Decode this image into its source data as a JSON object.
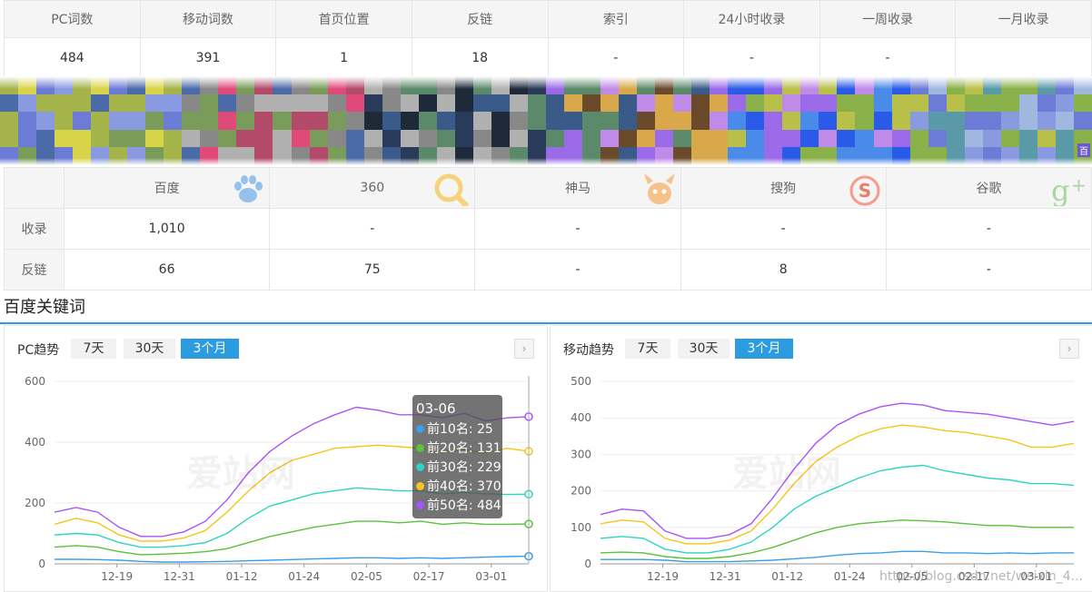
{
  "stats": {
    "headers": [
      "PC词数",
      "移动词数",
      "首页位置",
      "反链",
      "索引",
      "24小时收录",
      "一周收录",
      "一月收录"
    ],
    "values": [
      "484",
      "391",
      "1",
      "18",
      "-",
      "-",
      "-",
      ""
    ]
  },
  "banner": {
    "tag": "百"
  },
  "engines": {
    "headers": [
      "",
      "百度",
      "360",
      "神马",
      "搜狗",
      "谷歌"
    ],
    "icons": [
      "paw-icon",
      "magnifier-icon",
      "shenma-icon",
      "sogou-icon",
      "google-plus-icon"
    ],
    "rows": [
      {
        "label": "收录",
        "values": [
          "1,010",
          "-",
          "-",
          "-",
          "-"
        ]
      },
      {
        "label": "反链",
        "values": [
          "66",
          "75",
          "-",
          "8",
          "-"
        ]
      }
    ]
  },
  "section": {
    "title": "百度关键词"
  },
  "panels": [
    {
      "label": "PC趋势",
      "tabs": [
        {
          "label": "7天",
          "active": false
        },
        {
          "label": "30天",
          "active": false
        },
        {
          "label": "3个月",
          "active": true
        }
      ],
      "arrow": "›",
      "watermark": "爱站网"
    },
    {
      "label": "移动趋势",
      "tabs": [
        {
          "label": "7天",
          "active": false
        },
        {
          "label": "30天",
          "active": false
        },
        {
          "label": "3个月",
          "active": true
        }
      ],
      "arrow": "›",
      "watermark": "爱站网",
      "credit": "https://blog.csdn.net/weixin_4..."
    }
  ],
  "tooltip": {
    "date": "03-06",
    "rows": [
      {
        "label": "前10名: 25",
        "color": "#3a9ee8"
      },
      {
        "label": "前20名: 131",
        "color": "#5ac23a"
      },
      {
        "label": "前30名: 229",
        "color": "#2dd4bf"
      },
      {
        "label": "前40名: 370",
        "color": "#f5c518"
      },
      {
        "label": "前50名: 484",
        "color": "#a855f7"
      }
    ]
  },
  "chart_data": [
    {
      "type": "line",
      "title": "PC趋势",
      "xlabel": "",
      "ylabel": "",
      "ylim": [
        0,
        600
      ],
      "yticks": [
        0,
        200,
        400,
        600
      ],
      "xticks": [
        "12-19",
        "12-31",
        "01-12",
        "01-24",
        "02-05",
        "02-17",
        "03-01"
      ],
      "x": [
        "12-08",
        "12-12",
        "12-16",
        "12-20",
        "12-24",
        "12-28",
        "01-01",
        "01-05",
        "01-09",
        "01-13",
        "01-17",
        "01-21",
        "01-25",
        "01-29",
        "02-02",
        "02-06",
        "02-10",
        "02-14",
        "02-18",
        "02-22",
        "02-26",
        "03-02",
        "03-06"
      ],
      "series": [
        {
          "name": "前10名",
          "color": "#3a9ee8",
          "values": [
            15,
            15,
            14,
            12,
            8,
            6,
            6,
            7,
            8,
            10,
            12,
            14,
            16,
            18,
            20,
            20,
            18,
            20,
            18,
            20,
            22,
            24,
            25
          ]
        },
        {
          "name": "前20名",
          "color": "#5ac23a",
          "values": [
            55,
            60,
            55,
            40,
            30,
            32,
            35,
            40,
            50,
            70,
            90,
            105,
            120,
            130,
            140,
            140,
            135,
            140,
            130,
            135,
            130,
            130,
            131
          ]
        },
        {
          "name": "前30名",
          "color": "#2dd4bf",
          "values": [
            95,
            100,
            95,
            70,
            55,
            55,
            60,
            70,
            100,
            150,
            190,
            210,
            230,
            240,
            250,
            245,
            240,
            240,
            230,
            235,
            230,
            228,
            229
          ]
        },
        {
          "name": "前40名",
          "color": "#f5c518",
          "values": [
            130,
            150,
            135,
            95,
            75,
            75,
            85,
            110,
            170,
            240,
            300,
            340,
            360,
            380,
            385,
            390,
            385,
            380,
            370,
            375,
            365,
            380,
            370
          ]
        },
        {
          "name": "前50名",
          "color": "#a855f7",
          "values": [
            170,
            185,
            170,
            120,
            90,
            90,
            105,
            140,
            210,
            300,
            370,
            420,
            460,
            490,
            515,
            505,
            490,
            490,
            480,
            495,
            470,
            480,
            484
          ]
        }
      ]
    },
    {
      "type": "line",
      "title": "移动趋势",
      "xlabel": "",
      "ylabel": "",
      "ylim": [
        0,
        500
      ],
      "yticks": [
        0,
        100,
        200,
        300,
        400,
        500
      ],
      "xticks": [
        "12-19",
        "12-31",
        "01-12",
        "01-24",
        "02-05",
        "02-17",
        "03-01"
      ],
      "x": [
        "12-08",
        "12-12",
        "12-16",
        "12-20",
        "12-24",
        "12-28",
        "01-01",
        "01-05",
        "01-09",
        "01-13",
        "01-17",
        "01-21",
        "01-25",
        "01-29",
        "02-02",
        "02-06",
        "02-10",
        "02-14",
        "02-18",
        "02-22",
        "02-26",
        "03-02",
        "03-06"
      ],
      "series": [
        {
          "name": "前10名",
          "color": "#3a9ee8",
          "values": [
            12,
            12,
            12,
            10,
            6,
            6,
            6,
            8,
            10,
            14,
            18,
            24,
            28,
            30,
            34,
            34,
            30,
            30,
            28,
            30,
            28,
            30,
            30
          ]
        },
        {
          "name": "前20名",
          "color": "#5ac23a",
          "values": [
            30,
            32,
            30,
            20,
            15,
            15,
            20,
            30,
            45,
            65,
            85,
            100,
            110,
            115,
            120,
            118,
            115,
            110,
            105,
            105,
            100,
            100,
            100
          ]
        },
        {
          "name": "前30名",
          "color": "#2dd4bf",
          "values": [
            70,
            75,
            70,
            40,
            30,
            30,
            40,
            60,
            100,
            150,
            185,
            210,
            235,
            255,
            265,
            270,
            255,
            245,
            235,
            230,
            220,
            220,
            215
          ]
        },
        {
          "name": "前40名",
          "color": "#f5c518",
          "values": [
            110,
            120,
            115,
            70,
            55,
            55,
            65,
            90,
            150,
            220,
            280,
            320,
            350,
            370,
            380,
            375,
            365,
            360,
            350,
            340,
            320,
            320,
            330
          ]
        },
        {
          "name": "前50名",
          "color": "#a855f7",
          "values": [
            135,
            150,
            145,
            90,
            70,
            70,
            80,
            110,
            180,
            260,
            330,
            380,
            410,
            430,
            440,
            435,
            420,
            415,
            410,
            400,
            390,
            380,
            390
          ]
        }
      ]
    }
  ]
}
